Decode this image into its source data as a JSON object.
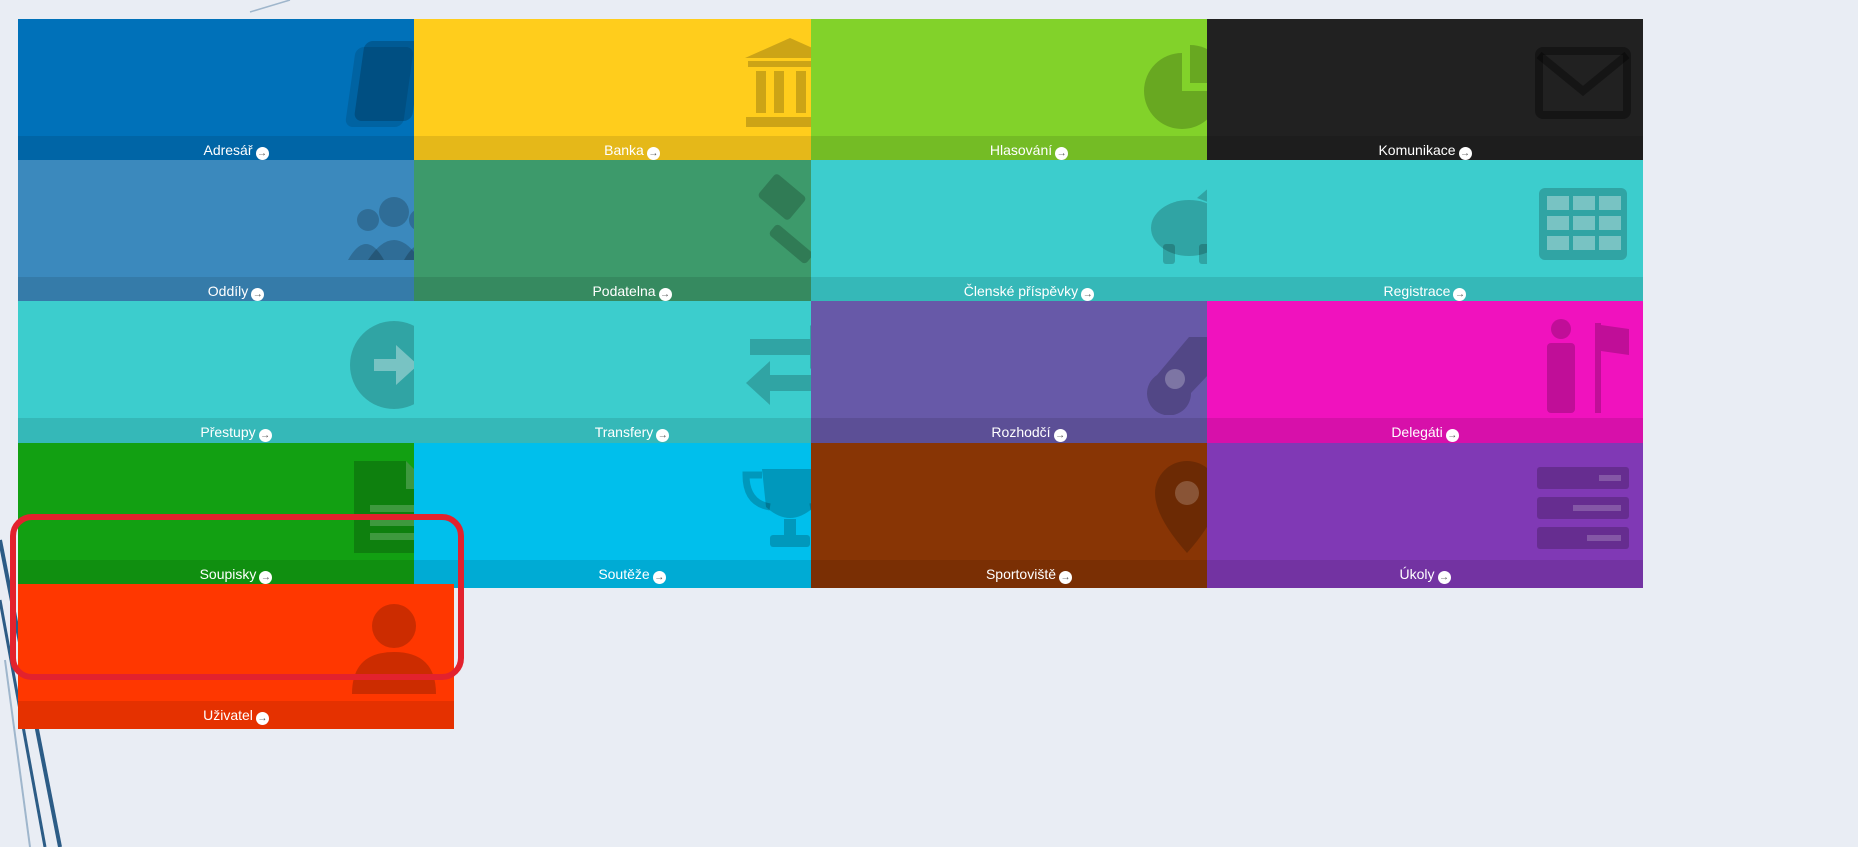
{
  "colors": {
    "background": "#e9edf4",
    "highlight": "#e3222d"
  },
  "tiles": [
    {
      "label": "Adresář",
      "icon": "address-book-icon",
      "color": "#0071b9"
    },
    {
      "label": "Banka",
      "icon": "bank-icon",
      "color": "#ffcd1c"
    },
    {
      "label": "Hlasování",
      "icon": "pie-chart-icon",
      "color": "#82d22a"
    },
    {
      "label": "Komunikace",
      "icon": "envelope-icon",
      "color": "#212121"
    },
    {
      "label": "Oddíly",
      "icon": "users-icon",
      "color": "#3b89bd"
    },
    {
      "label": "Podatelna",
      "icon": "gavel-icon",
      "color": "#3d9a6b"
    },
    {
      "label": "Členské příspěvky",
      "icon": "piggy-bank-icon",
      "color": "#3ccdcd"
    },
    {
      "label": "Registrace",
      "icon": "table-icon",
      "color": "#3ccdcd"
    },
    {
      "label": "Přestupy",
      "icon": "arrow-circle-right-icon",
      "color": "#3ccdcd"
    },
    {
      "label": "Transfery",
      "icon": "exchange-icon",
      "color": "#3ccdcd"
    },
    {
      "label": "Rozhodčí",
      "icon": "whistle-icon",
      "color": "#6759a8"
    },
    {
      "label": "Delegáti",
      "icon": "delegate-flag-icon",
      "color": "#f012be"
    },
    {
      "label": "Soupisky",
      "icon": "document-icon",
      "color": "#12a012"
    },
    {
      "label": "Soutěže",
      "icon": "trophy-icon",
      "color": "#00bfec"
    },
    {
      "label": "Sportoviště",
      "icon": "map-marker-icon",
      "color": "#883505"
    },
    {
      "label": "Úkoly",
      "icon": "tasks-icon",
      "color": "#8039b5"
    },
    {
      "label": "Uživatel",
      "icon": "user-icon",
      "color": "#ff3700"
    }
  ]
}
